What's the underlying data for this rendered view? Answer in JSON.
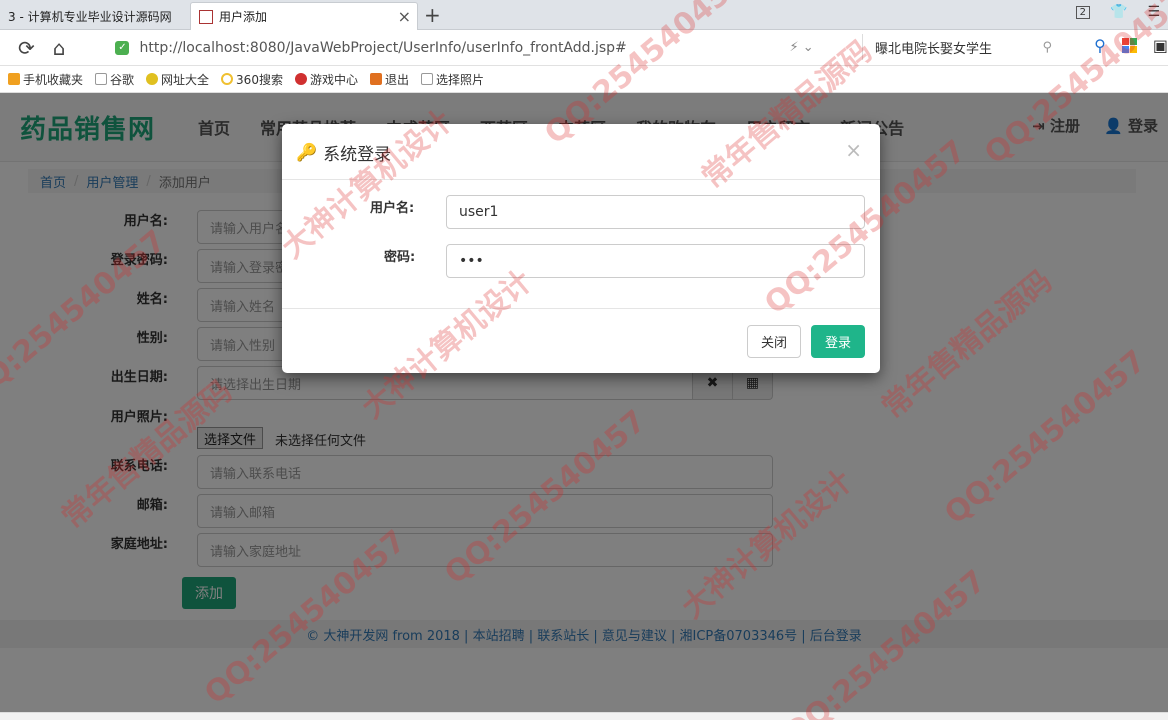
{
  "browser": {
    "tabs": [
      {
        "label": "3 - 计算机专业毕业设计源码网"
      },
      {
        "label": "用户添加"
      }
    ],
    "tab_count_badge": "2",
    "url": "http://localhost:8080/JavaWebProject/UserInfo/userInfo_frontAdd.jsp#",
    "search_text": "曝北电院长娶女学生",
    "bookmarks": [
      {
        "label": "手机收藏夹",
        "color": "#f0a020"
      },
      {
        "label": "谷歌",
        "color": "#ffffff"
      },
      {
        "label": "网址大全",
        "color": "#e0c020"
      },
      {
        "label": "360搜索",
        "color": "#f0c030"
      },
      {
        "label": "游戏中心",
        "color": "#d03030"
      },
      {
        "label": "退出",
        "color": "#e07020"
      },
      {
        "label": "选择照片",
        "color": "#ffffff"
      }
    ]
  },
  "site": {
    "logo": "药品销售网",
    "menu": [
      "首页",
      "常用药品推荐",
      "中成药区",
      "西药区",
      "中药区",
      "我的购物车",
      "用户留言",
      "新闻公告"
    ],
    "register": "注册",
    "login": "登录"
  },
  "breadcrumb": [
    "首页",
    "用户管理",
    "添加用户"
  ],
  "form": {
    "fields": [
      {
        "label": "用户名:",
        "placeholder": "请输入用户名"
      },
      {
        "label": "登录密码:",
        "placeholder": "请输入登录密码"
      },
      {
        "label": "姓名:",
        "placeholder": "请输入姓名"
      },
      {
        "label": "性别:",
        "placeholder": "请输入性别"
      },
      {
        "label": "出生日期:",
        "placeholder": "请选择出生日期"
      },
      {
        "label": "用户照片:",
        "file_button": "选择文件",
        "file_status": "未选择任何文件"
      },
      {
        "label": "联系电话:",
        "placeholder": "请输入联系电话"
      },
      {
        "label": "邮箱:",
        "placeholder": "请输入邮箱"
      },
      {
        "label": "家庭地址:",
        "placeholder": "请输入家庭地址"
      }
    ],
    "submit": "添加"
  },
  "footer": "© 大神开发网 from 2018 | 本站招聘 | 联系站长 | 意见与建议 | 湘ICP备0703346号 | 后台登录",
  "modal": {
    "title": "系统登录",
    "username_label": "用户名:",
    "username_value": "user1",
    "password_label": "密码:",
    "password_value": "•••",
    "close_button": "关闭",
    "login_button": "登录"
  },
  "watermark": [
    "QQ:254540457",
    "大神计算机设计",
    "常年售精品源码"
  ],
  "colors": {
    "brand": "#1fa67a",
    "login_button": "#1fb58a",
    "link": "#337ab7"
  }
}
